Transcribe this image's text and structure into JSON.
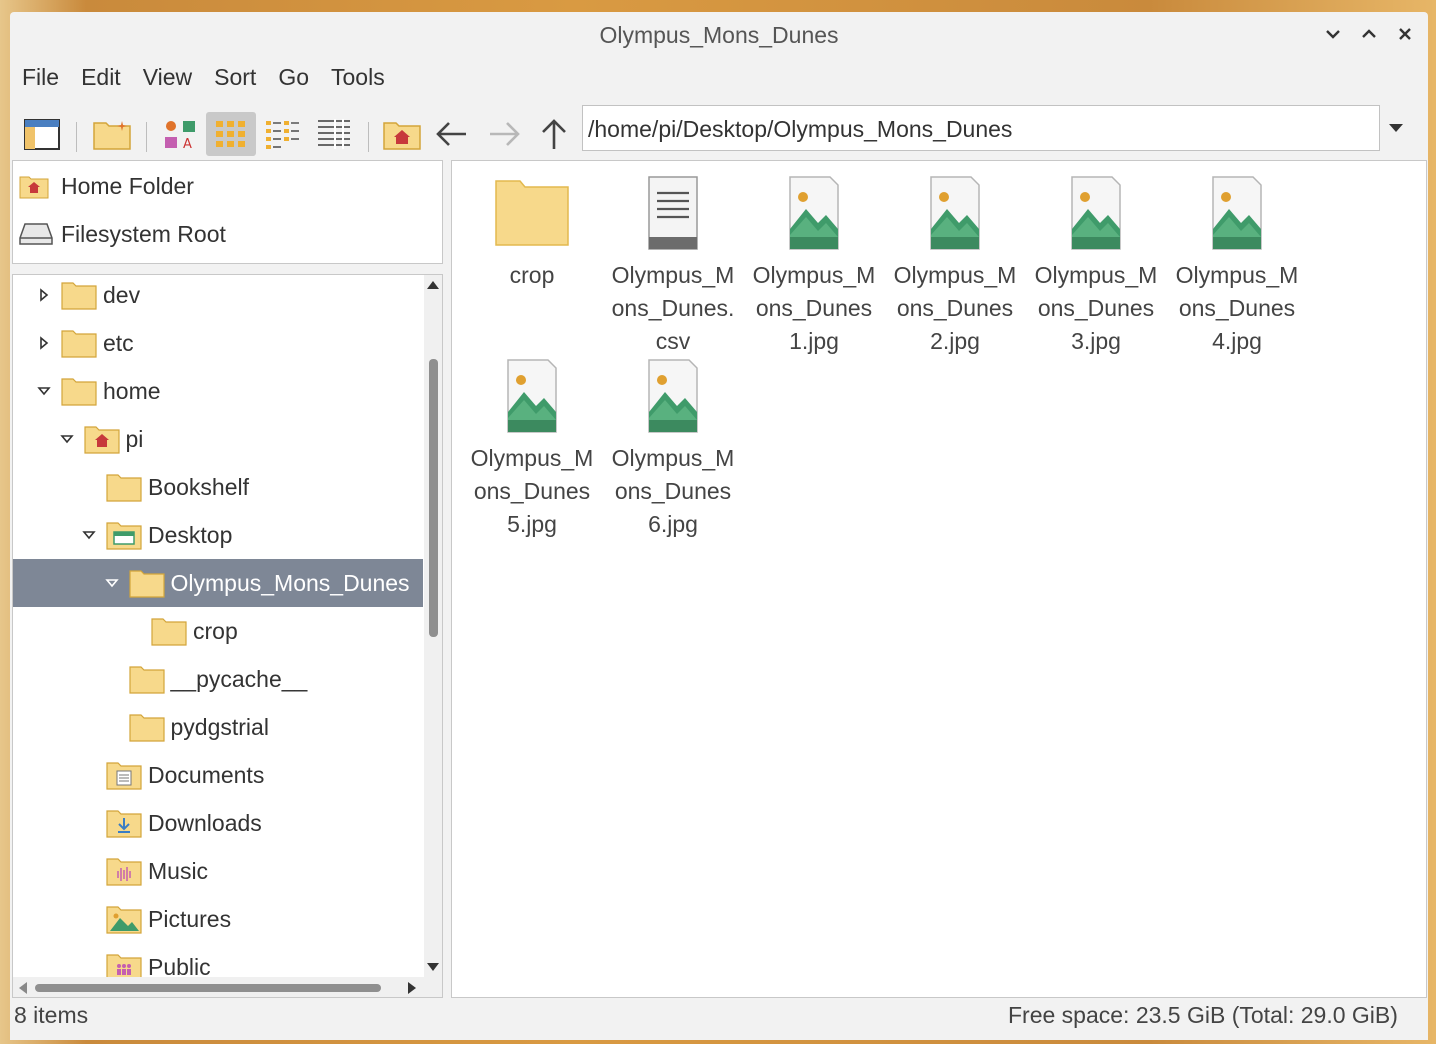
{
  "window": {
    "title": "Olympus_Mons_Dunes"
  },
  "menubar": [
    "File",
    "Edit",
    "View",
    "Sort",
    "Go",
    "Tools"
  ],
  "address": {
    "path": "/home/pi/Desktop/Olympus_Mons_Dunes"
  },
  "places": [
    {
      "label": "Home Folder",
      "icon": "home-folder-icon"
    },
    {
      "label": "Filesystem Root",
      "icon": "drive-icon"
    }
  ],
  "tree": [
    {
      "label": "dev",
      "level": 0,
      "expander": "collapsed",
      "icon": "folder"
    },
    {
      "label": "etc",
      "level": 0,
      "expander": "collapsed",
      "icon": "folder"
    },
    {
      "label": "home",
      "level": 0,
      "expander": "expanded",
      "icon": "folder"
    },
    {
      "label": "pi",
      "level": 1,
      "expander": "expanded",
      "icon": "home"
    },
    {
      "label": "Bookshelf",
      "level": 2,
      "expander": "none",
      "icon": "folder"
    },
    {
      "label": "Desktop",
      "level": 2,
      "expander": "expanded",
      "icon": "desktop"
    },
    {
      "label": "Olympus_Mons_Dunes",
      "level": 3,
      "expander": "expanded",
      "icon": "folder",
      "selected": true
    },
    {
      "label": "crop",
      "level": 4,
      "expander": "none",
      "icon": "folder"
    },
    {
      "label": "__pycache__",
      "level": 3,
      "expander": "none",
      "icon": "folder"
    },
    {
      "label": "pydgstrial",
      "level": 3,
      "expander": "none",
      "icon": "folder"
    },
    {
      "label": "Documents",
      "level": 2,
      "expander": "none",
      "icon": "documents"
    },
    {
      "label": "Downloads",
      "level": 2,
      "expander": "none",
      "icon": "downloads"
    },
    {
      "label": "Music",
      "level": 2,
      "expander": "none",
      "icon": "music"
    },
    {
      "label": "Pictures",
      "level": 2,
      "expander": "none",
      "icon": "pictures"
    },
    {
      "label": "Public",
      "level": 2,
      "expander": "none",
      "icon": "public"
    }
  ],
  "files": [
    {
      "name": "crop",
      "type": "folder"
    },
    {
      "name": "Olympus_Mons_Dunes.csv",
      "type": "text"
    },
    {
      "name": "Olympus_Mons_Dunes1.jpg",
      "type": "image"
    },
    {
      "name": "Olympus_Mons_Dunes2.jpg",
      "type": "image"
    },
    {
      "name": "Olympus_Mons_Dunes3.jpg",
      "type": "image"
    },
    {
      "name": "Olympus_Mons_Dunes4.jpg",
      "type": "image"
    },
    {
      "name": "Olympus_Mons_Dunes5.jpg",
      "type": "image"
    },
    {
      "name": "Olympus_Mons_Dunes6.jpg",
      "type": "image"
    }
  ],
  "status": {
    "items": "8 items",
    "free_space": "Free space: 23.5 GiB (Total: 29.0 GiB)"
  },
  "colors": {
    "selection": "#7e8796",
    "folder": "#f7d98b",
    "image_green": "#3f9b6a"
  }
}
